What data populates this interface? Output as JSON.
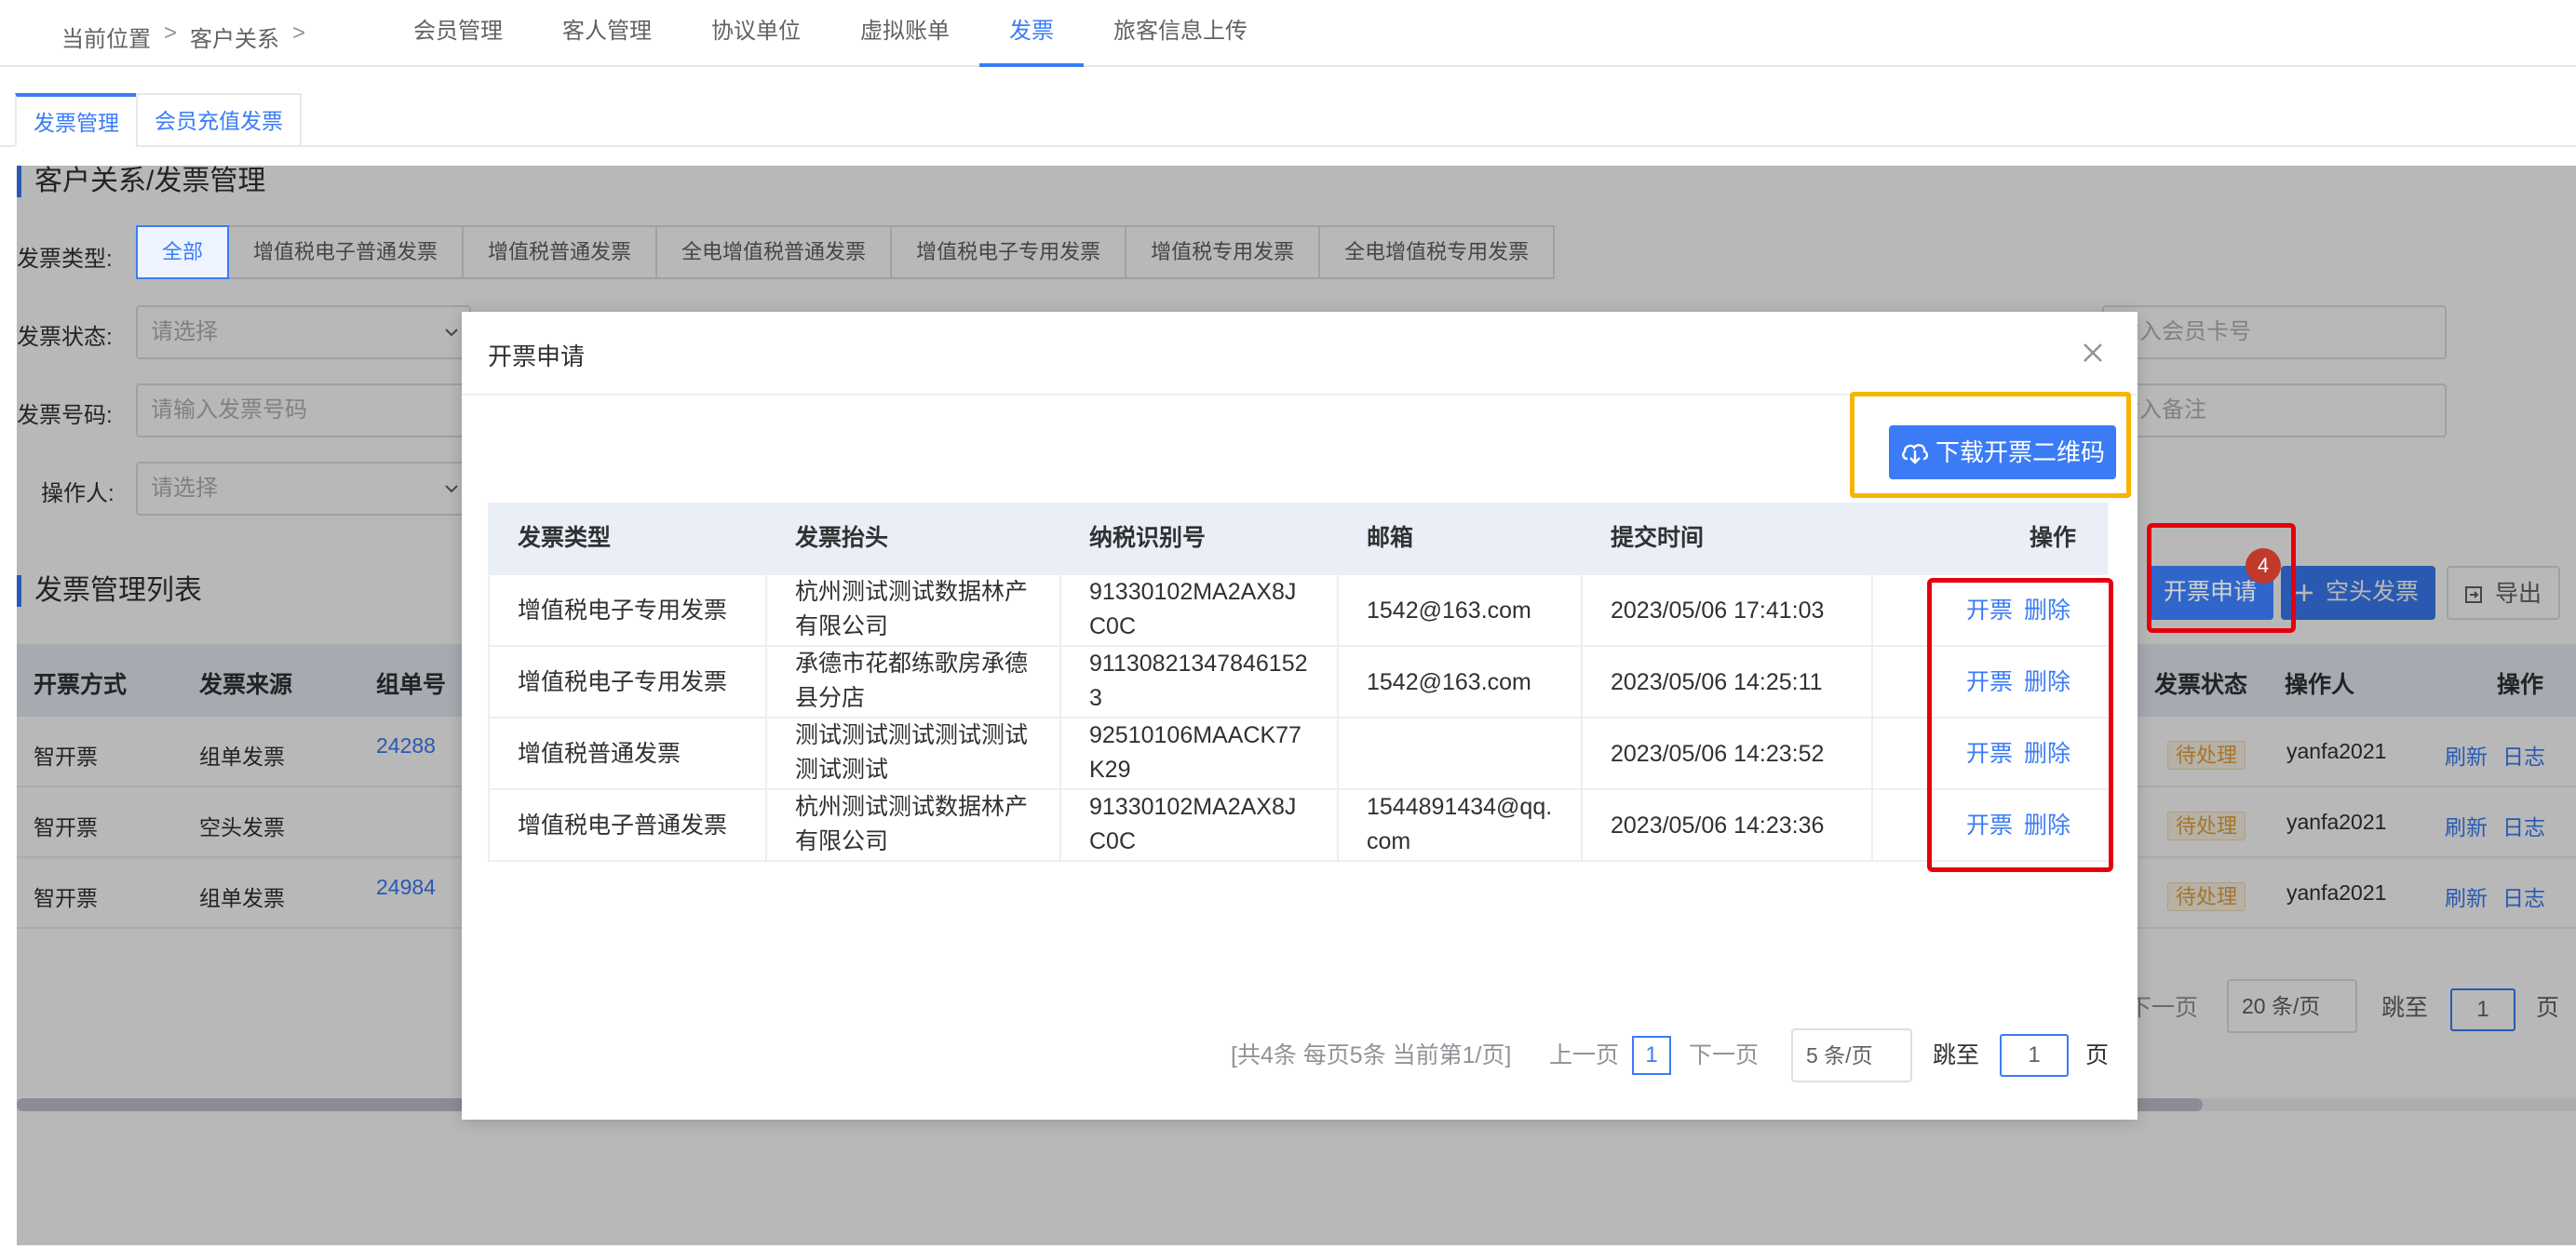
{
  "breadcrumb": {
    "label": "当前位置",
    "sep1": ">",
    "item": "客户关系",
    "sep2": ">"
  },
  "nav_tabs": [
    "会员管理",
    "客人管理",
    "协议单位",
    "虚拟账单",
    "发票",
    "旅客信息上传"
  ],
  "nav_active": "发票",
  "sub_tabs": [
    "发票管理",
    "会员充值发票"
  ],
  "page_title": "客户关系/发票管理",
  "filters": {
    "invoice_type_label": "发票类型:",
    "invoice_types": [
      "全部",
      "增值税电子普通发票",
      "增值税普通发票",
      "全电增值税普通发票",
      "增值税电子专用发票",
      "增值税专用发票",
      "全电增值税专用发票"
    ],
    "status_label": "发票状态:",
    "status_placeholder": "请选择",
    "number_label": "发票号码:",
    "number_placeholder": "请输入发票号码",
    "operator_label": "操作人:",
    "operator_placeholder": "请选择",
    "member_card_placeholder": "输入会员卡号",
    "remark_placeholder": "输入备注"
  },
  "list": {
    "title": "发票管理列表",
    "apply_button": "开票申请",
    "apply_badge": "4",
    "blank_button": "空头发票",
    "export_button": "导出",
    "columns": [
      "开票方式",
      "发票来源",
      "组单号",
      "发票状态",
      "操作人",
      "操作"
    ],
    "rows": [
      {
        "method": "智开票",
        "source": "组单发票",
        "order_no": "24288",
        "status": "待处理",
        "operator": "yanfa2021",
        "refresh": "刷新",
        "log": "日志"
      },
      {
        "method": "智开票",
        "source": "空头发票",
        "order_no": "",
        "status": "待处理",
        "operator": "yanfa2021",
        "refresh": "刷新",
        "log": "日志"
      },
      {
        "method": "智开票",
        "source": "组单发票",
        "order_no": "24984",
        "status": "待处理",
        "operator": "yanfa2021",
        "refresh": "刷新",
        "log": "日志"
      }
    ],
    "pager": {
      "next": "下一页",
      "page_size": "20 条/页",
      "goto_label": "跳至",
      "goto_value": "1",
      "page_unit": "页"
    }
  },
  "dialog": {
    "title": "开票申请",
    "download_button": "下载开票二维码",
    "columns": [
      "发票类型",
      "发票抬头",
      "纳税识别号",
      "邮箱",
      "提交时间",
      "操作"
    ],
    "rows": [
      {
        "type": "增值税电子专用发票",
        "header": "杭州测试测试数据林产有限公司",
        "tax_id": "91330102MA2AX8JC0C",
        "email": "1542@163.com",
        "time": "2023/05/06 17:41:03",
        "op1": "开票",
        "op2": "删除"
      },
      {
        "type": "增值税电子专用发票",
        "header": "承德市花都练歌房承德县分店",
        "tax_id": "911308213478461523",
        "email": "1542@163.com",
        "time": "2023/05/06 14:25:11",
        "op1": "开票",
        "op2": "删除"
      },
      {
        "type": "增值税普通发票",
        "header": "测试测试测试测试测试测试测试",
        "tax_id": "92510106MAACK77K29",
        "email": "",
        "time": "2023/05/06 14:23:52",
        "op1": "开票",
        "op2": "删除"
      },
      {
        "type": "增值税电子普通发票",
        "header": "杭州测试测试数据林产有限公司",
        "tax_id": "91330102MA2AX8JC0C",
        "email": "1544891434@qq.com",
        "time": "2023/05/06 14:23:36",
        "op1": "开票",
        "op2": "删除"
      }
    ],
    "pager": {
      "summary": "[共4条 每页5条 当前第1/页]",
      "prev": "上一页",
      "current": "1",
      "next": "下一页",
      "page_size": "5 条/页",
      "goto_label": "跳至",
      "goto_value": "1",
      "page_unit": "页"
    }
  },
  "colors": {
    "accent": "#3b7cf6",
    "highlight_yellow": "#f7b500",
    "highlight_red": "#e5000f",
    "badge": "#c0392b"
  }
}
